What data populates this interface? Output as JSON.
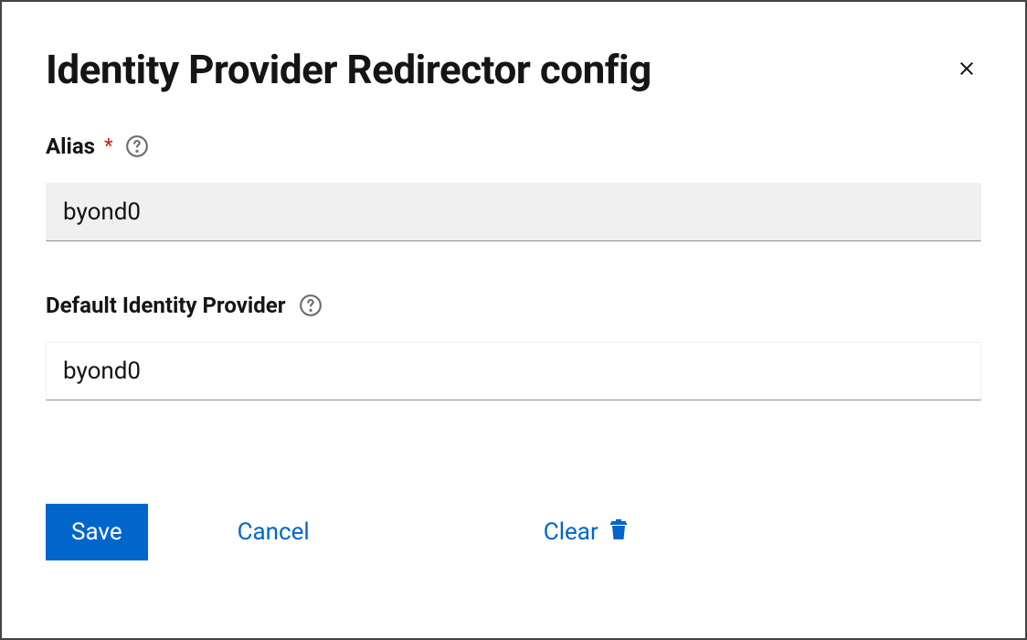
{
  "modal": {
    "title": "Identity Provider Redirector config"
  },
  "form": {
    "alias": {
      "label": "Alias",
      "value": "byond0"
    },
    "defaultIdp": {
      "label": "Default Identity Provider",
      "value": "byond0"
    }
  },
  "footer": {
    "save": "Save",
    "cancel": "Cancel",
    "clear": "Clear"
  }
}
